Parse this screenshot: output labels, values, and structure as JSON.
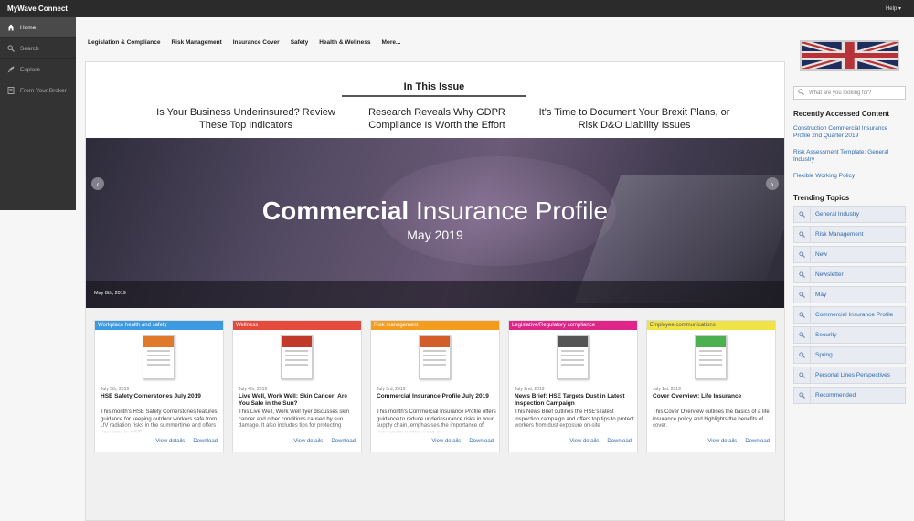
{
  "app": {
    "title": "MyWave Connect",
    "help_label": "Help ▾"
  },
  "sidebar": {
    "items": [
      {
        "label": "Home",
        "icon": "home-icon"
      },
      {
        "label": "Search",
        "icon": "search-icon"
      },
      {
        "label": "Explore",
        "icon": "rocket-icon"
      },
      {
        "label": "From Your Broker",
        "icon": "document-icon"
      }
    ]
  },
  "nav": {
    "items": [
      "Legislation & Compliance",
      "Risk Management",
      "Insurance Cover",
      "Safety",
      "Health & Wellness",
      "More..."
    ]
  },
  "issue": {
    "title": "In This Issue",
    "headlines": [
      "Is Your Business Underinsured? Review These Top Indicators",
      "Research Reveals Why GDPR Compliance Is Worth the Effort",
      "It's Time to Document Your Brexit Plans, or Risk D&O Liability Issues"
    ]
  },
  "hero": {
    "title_bold": "Commercial",
    "title_rest": " Insurance Profile",
    "subtitle": "May 2019",
    "date": "May 8th, 2019"
  },
  "cards": [
    {
      "tag": "Workplace health and safety",
      "color": "#3d9ae0",
      "date": "July 5th, 2019",
      "title": "HSE Safety Cornerstones July 2019",
      "desc": "This month's HSE Safety Cornerstones features guidance for keeping outdoor workers safe from UV radiation risks in the summertime and offers the latest in HSE",
      "view": "View details",
      "download": "Download"
    },
    {
      "tag": "Wellness",
      "color": "#e64a3c",
      "date": "July 4th, 2019",
      "title": "Live Well, Work Well: Skin Cancer: Are You Safe in the Sun?",
      "desc": "This Live Well, Work Well flyer discusses skin cancer and other conditions caused by sun damage. It also includes tips for protecting",
      "view": "View details",
      "download": "Download"
    },
    {
      "tag": "Risk management",
      "color": "#f39c1e",
      "date": "July 3rd, 2019",
      "title": "Commercial Insurance Profile July 2019",
      "desc": "This month's Commercial Insurance Profile offers guidance to reduce underinsurance risks in your supply chain, emphasises the importance of purchasing robust cover to",
      "view": "View details",
      "download": "Download"
    },
    {
      "tag": "Legislative/Regulatory compliance",
      "color": "#e02589",
      "date": "July 2nd, 2019",
      "title": "News Brief: HSE Targets Dust in Latest Inspection Campaign",
      "desc": "This News Brief outlines the HSE's latest inspection campaign and offers top tips to protect workers from dust exposure on-site",
      "view": "View details",
      "download": "Download"
    },
    {
      "tag": "Employee communications",
      "color": "#f0e346",
      "date": "July 1st, 2019",
      "title": "Cover Overview: Life Insurance",
      "desc": "This Cover Overview outlines the basics of a life insurance policy and highlights the benefits of cover.",
      "view": "View details",
      "download": "Download"
    }
  ],
  "right": {
    "search_placeholder": "What are you looking for?",
    "recent_title": "Recently Accessed Content",
    "recent": [
      "Construction Commercial Insurance Profile 2nd Quarter 2019",
      "Risk Assessment Template: General Industry",
      "Flexible Working Policy"
    ],
    "trending_title": "Trending Topics",
    "topics": [
      "General Industry",
      "Risk Management",
      "New",
      "Newsletter",
      "May",
      "Commercial Insurance Profile",
      "Security",
      "Spring",
      "Personal Lines Perspectives",
      "Recommended"
    ]
  }
}
